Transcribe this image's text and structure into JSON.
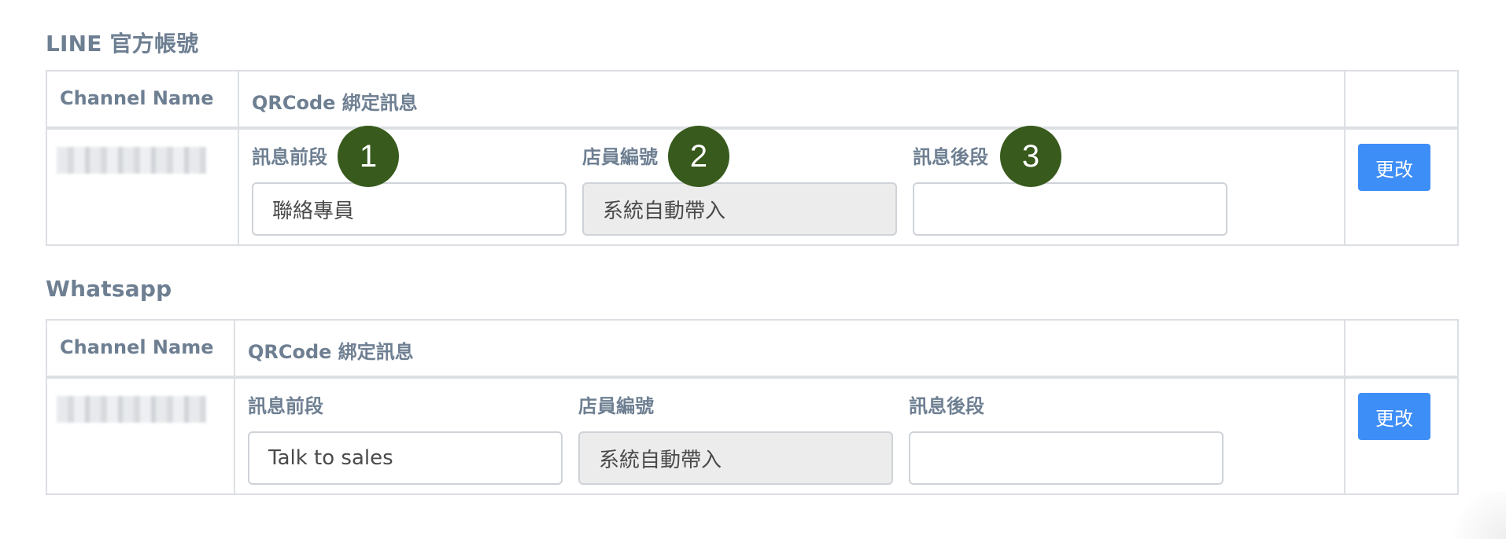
{
  "sections": [
    {
      "title": "LINE 官方帳號",
      "header": {
        "channel_name": "Channel Name",
        "qrcode_message": "QRCode 綁定訊息"
      },
      "row": {
        "prefix_label": "訊息前段",
        "prefix_value": "聯絡專員",
        "staff_label": "店員編號",
        "staff_value": "系統自動帶入",
        "suffix_label": "訊息後段",
        "suffix_value": "",
        "update_label": "更改"
      }
    },
    {
      "title": "Whatsapp",
      "header": {
        "channel_name": "Channel Name",
        "qrcode_message": "QRCode 綁定訊息"
      },
      "row": {
        "prefix_label": "訊息前段",
        "prefix_value": "Talk to sales",
        "staff_label": "店員編號",
        "staff_value": "系統自動帶入",
        "suffix_label": "訊息後段",
        "suffix_value": "",
        "update_label": "更改"
      }
    }
  ],
  "markers": [
    "1",
    "2",
    "3"
  ],
  "colors": {
    "label_text": "#6e7f92",
    "border": "#dcdfe3",
    "button_bg": "#3e8ef7",
    "marker_bg": "#385a1c",
    "readonly_bg": "#ececec"
  }
}
